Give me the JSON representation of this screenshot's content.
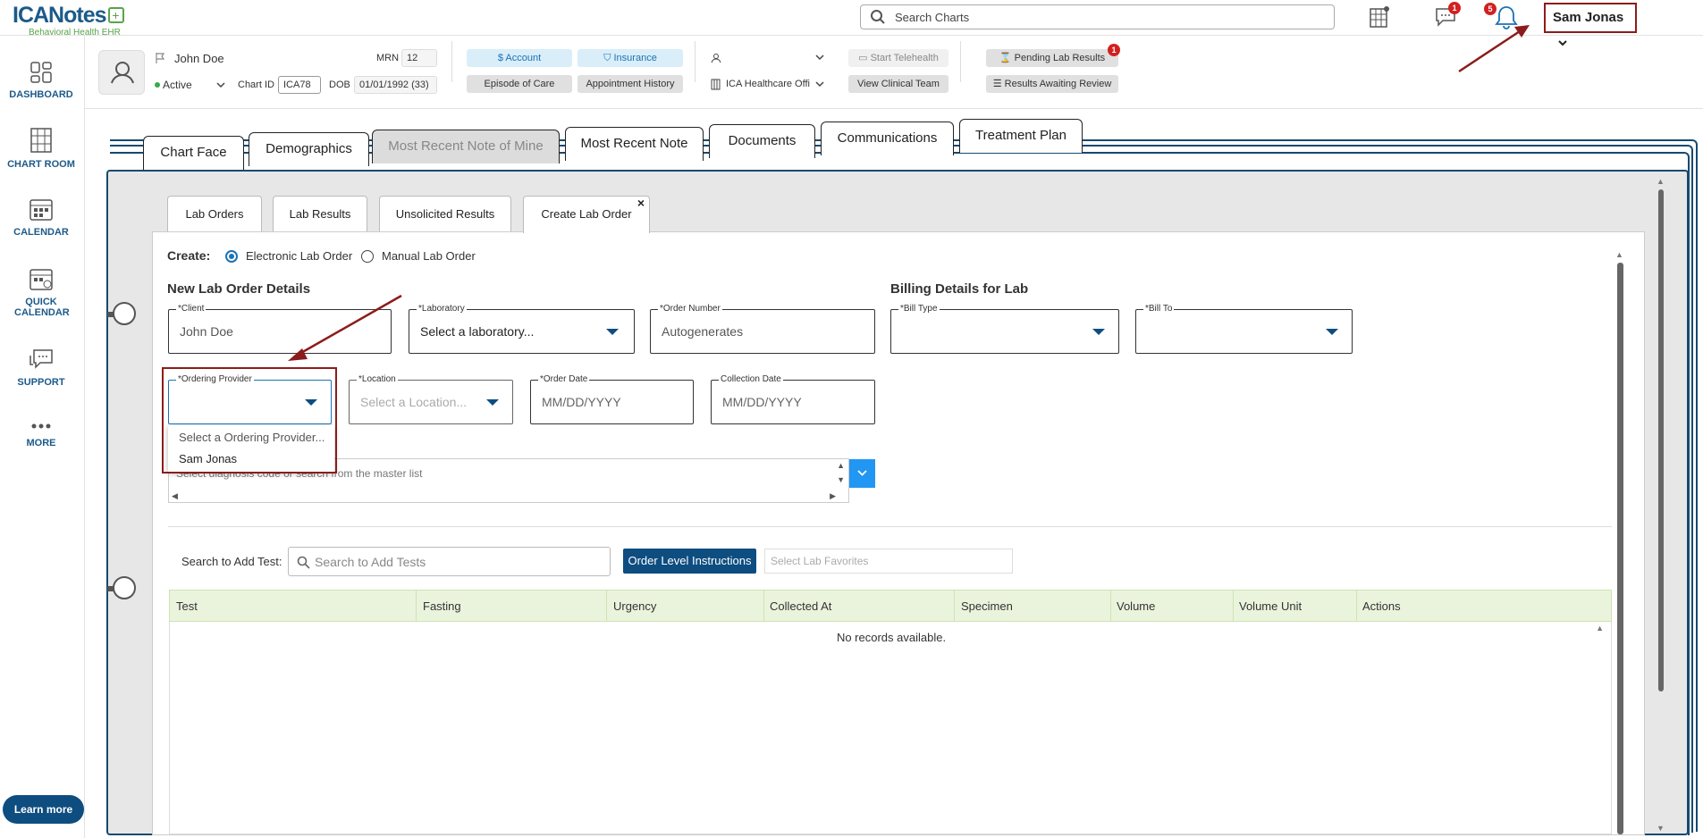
{
  "brand": {
    "name": "ICANotes",
    "plus": "+",
    "subtitle": "Behavioral Health EHR"
  },
  "search": {
    "placeholder": "Search Charts"
  },
  "notifications": {
    "messages_badge": "1",
    "alerts_badge": "5"
  },
  "user_menu": {
    "label": "Sam Jonas"
  },
  "sidebar": {
    "items": [
      {
        "label": "DASHBOARD"
      },
      {
        "label": "CHART ROOM"
      },
      {
        "label": "CALENDAR"
      },
      {
        "label": "QUICK CALENDAR"
      },
      {
        "label": "SUPPORT"
      },
      {
        "label": "MORE"
      }
    ],
    "learn_more": "Learn more"
  },
  "patient": {
    "name": "John Doe",
    "status": "Active",
    "mrn_label": "MRN",
    "mrn": "12",
    "chart_id_label": "Chart ID",
    "chart_id": "ICA78",
    "dob_label": "DOB",
    "dob": "01/01/1992 (33)",
    "account": "Account",
    "insurance": "Insurance",
    "episode_of_care": "Episode of Care",
    "appointment_history": "Appointment History",
    "start_telehealth": "Start Telehealth",
    "facility": "ICA Healthcare Offi",
    "view_clinical_team": "View Clinical Team",
    "pending_lab_results": "Pending Lab Results",
    "pending_badge": "1",
    "results_awaiting_review": "Results Awaiting Review"
  },
  "main_tabs": [
    "Chart Face",
    "Demographics",
    "Most Recent Note of Mine",
    "Most Recent Note",
    "Documents",
    "Communications",
    "Treatment Plan"
  ],
  "sub_tabs": [
    "Lab Orders",
    "Lab Results",
    "Unsolicited Results",
    "Create Lab Order"
  ],
  "sub_tab_close": "×",
  "create": {
    "label": "Create:",
    "option_electronic": "Electronic Lab Order",
    "option_manual": "Manual Lab Order"
  },
  "sections": {
    "details": "New Lab Order Details",
    "billing": "Billing Details for Lab"
  },
  "fields": {
    "client": {
      "label": "*Client",
      "value": "John Doe"
    },
    "laboratory": {
      "label": "*Laboratory",
      "value": "Select a laboratory..."
    },
    "order_number": {
      "label": "*Order Number",
      "value": "Autogenerates"
    },
    "bill_type": {
      "label": "*Bill Type",
      "value": ""
    },
    "bill_to": {
      "label": "*Bill To",
      "value": ""
    },
    "ordering_provider": {
      "label": "*Ordering Provider",
      "value": ""
    },
    "location": {
      "label": "*Location",
      "placeholder": "Select a Location..."
    },
    "order_date": {
      "label": "*Order Date",
      "placeholder": "MM/DD/YYYY"
    },
    "collection_date": {
      "label": "Collection Date",
      "placeholder": "MM/DD/YYYY"
    }
  },
  "provider_dropdown": {
    "options": [
      "Select a Ordering Provider...",
      "Sam Jonas"
    ]
  },
  "diagnosis": {
    "placeholder": "Select diagnosis code or search from the master list"
  },
  "tests": {
    "search_label": "Search to Add Test:",
    "search_placeholder": "Search to Add Tests",
    "order_level_instructions": "Order Level Instructions",
    "favorites_placeholder": "Select Lab Favorites",
    "columns": [
      "Test",
      "Fasting",
      "Urgency",
      "Collected At",
      "Specimen",
      "Volume",
      "Volume Unit",
      "Actions"
    ],
    "empty": "No records available."
  },
  "colors": {
    "brand_blue": "#0e4d80",
    "highlight_red": "#8c1c1c",
    "accent_green": "#5aa34a",
    "badge_red": "#d32020"
  }
}
